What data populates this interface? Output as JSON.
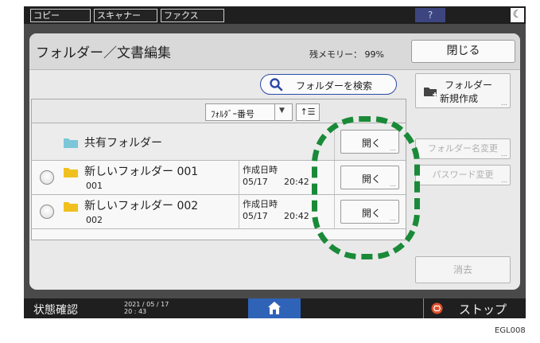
{
  "top_bar": {
    "tabs": [
      "コピー",
      "スキャナー",
      "ファクス"
    ],
    "help_label": "?",
    "night_label": "☾"
  },
  "header": {
    "title": "フォルダー／文書編集",
    "memory": "残メモリー： 99%",
    "close_label": "閉じる"
  },
  "search": {
    "label": "フォルダーを検索",
    "icon": "search-icon"
  },
  "side_buttons": {
    "new_folder_line1": "フォルダー",
    "new_folder_line2": "新規作成",
    "rename_label": "フォルダー名変更",
    "password_label": "パスワード変更",
    "delete_label": "消去",
    "more": "…"
  },
  "list": {
    "sort_label": "ﾌｫﾙﾀﾞｰ番号",
    "sort_order_label": "↑☰",
    "shared_folder": "共有フォルダー",
    "open_label": "開く",
    "more": "…",
    "rows": [
      {
        "name": "新しいフォルダー 001",
        "number": "001",
        "date_label": "作成日時",
        "date": "05/17",
        "time": "20:42"
      },
      {
        "name": "新しいフォルダー 002",
        "number": "002",
        "date_label": "作成日時",
        "date": "05/17",
        "time": "20:42"
      }
    ]
  },
  "bottom_bar": {
    "status_label": "状態確認",
    "date": "2021 / 05 / 17",
    "time": "20 : 43",
    "stop_label": "ストップ"
  },
  "figure_label": "EGL008",
  "colors": {
    "accent_blue": "#2d4aa8",
    "folder_yellow": "#f0c020",
    "shared_folder_teal": "#7cc6d8",
    "highlight_green": "#1a8a38",
    "stop_red": "#e0502a",
    "home_blue": "#2f63b8"
  }
}
